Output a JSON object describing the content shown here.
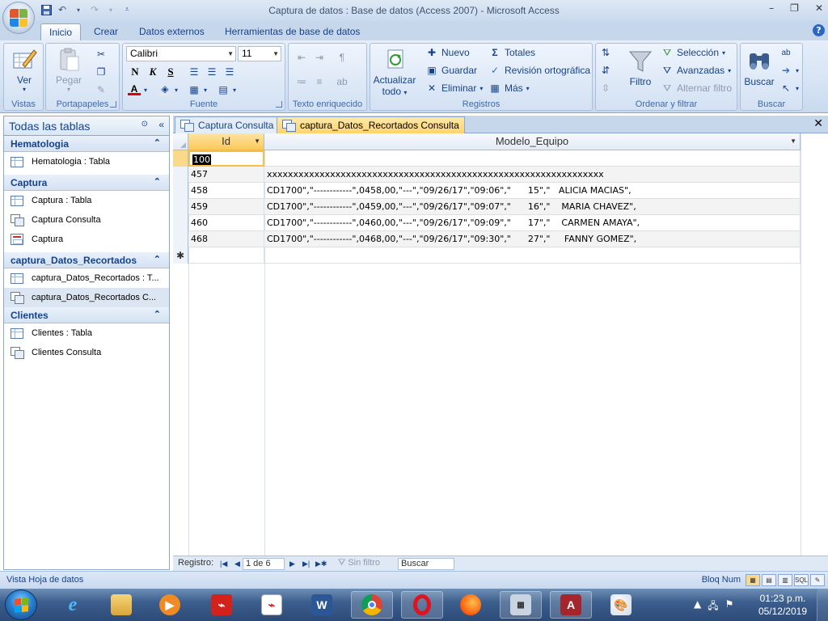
{
  "window": {
    "title": "Captura de datos : Base de datos (Access 2007) - Microsoft Access",
    "controls": [
      "–",
      "❐",
      "✕"
    ]
  },
  "ribbon": {
    "tabs": [
      "Inicio",
      "Crear",
      "Datos externos",
      "Herramientas de base de datos"
    ],
    "active_tab": "Inicio",
    "groups": {
      "vistas": {
        "label": "Vistas",
        "ver": "Ver"
      },
      "portapapeles": {
        "label": "Portapapeles",
        "pegar": "Pegar"
      },
      "fuente": {
        "label": "Fuente",
        "font": "Calibri",
        "size": "11",
        "bold": "N",
        "italic": "K",
        "underline": "S"
      },
      "texto": {
        "label": "Texto enriquecido"
      },
      "registros": {
        "label": "Registros",
        "actualizar": "Actualizar",
        "todo": "todo",
        "nuevo": "Nuevo",
        "guardar": "Guardar",
        "eliminar": "Eliminar",
        "totales": "Totales",
        "revision": "Revisión ortográfica",
        "mas": "Más"
      },
      "ordenar": {
        "label": "Ordenar y filtrar",
        "filtro": "Filtro",
        "seleccion": "Selección",
        "avanzadas": "Avanzadas",
        "alternar": "Alternar filtro"
      },
      "buscar": {
        "label": "Buscar",
        "buscar": "Buscar"
      }
    }
  },
  "navpane": {
    "title": "Todas las tablas",
    "groups": [
      {
        "name": "Hematologia",
        "items": [
          {
            "type": "table",
            "label": "Hematologia : Tabla"
          }
        ]
      },
      {
        "name": "Captura",
        "items": [
          {
            "type": "table",
            "label": "Captura : Tabla"
          },
          {
            "type": "query",
            "label": "Captura Consulta"
          },
          {
            "type": "form",
            "label": "Captura"
          }
        ]
      },
      {
        "name": "captura_Datos_Recortados",
        "items": [
          {
            "type": "table",
            "label": "captura_Datos_Recortados : T..."
          },
          {
            "type": "query",
            "label": "captura_Datos_Recortados C...",
            "selected": true
          }
        ]
      },
      {
        "name": "Clientes",
        "items": [
          {
            "type": "table",
            "label": "Clientes : Tabla"
          },
          {
            "type": "query",
            "label": "Clientes Consulta"
          }
        ]
      }
    ]
  },
  "doc_tabs": [
    {
      "label": "Captura Consulta",
      "active": false
    },
    {
      "label": "captura_Datos_Recortados Consulta",
      "active": true
    }
  ],
  "datasheet": {
    "columns": [
      "Id",
      "Modelo_Equipo"
    ],
    "rows": [
      {
        "id": "100",
        "modelo": ""
      },
      {
        "id": "457",
        "modelo": "xxxxxxxxxxxxxxxxxxxxxxxxxxxxxxxxxxxxxxxxxxxxxxxxxxxxxxxxxxxxxxxx"
      },
      {
        "id": "458",
        "modelo": "CD1700\",\"------------\",0458,00,\"---\",\"09/26/17\",\"09:06\",\"      15\",\"   ALICIA MACIAS\","
      },
      {
        "id": "459",
        "modelo": "CD1700\",\"------------\",0459,00,\"---\",\"09/26/17\",\"09:07\",\"      16\",\"    MARIA CHAVEZ\","
      },
      {
        "id": "460",
        "modelo": "CD1700\",\"------------\",0460,00,\"---\",\"09/26/17\",\"09:09\",\"      17\",\"    CARMEN AMAYA\","
      },
      {
        "id": "468",
        "modelo": "CD1700\",\"------------\",0468,00,\"---\",\"09/26/17\",\"09:30\",\"      27\",\"     FANNY GOMEZ\","
      }
    ],
    "new_row_marker": "✱"
  },
  "record_nav": {
    "label": "Registro:",
    "position": "1 de 6",
    "filter": "Sin filtro",
    "search": "Buscar"
  },
  "status": {
    "left": "Vista Hoja de datos",
    "right": "Bloq Num"
  },
  "taskbar": {
    "time": "01:23 p.m.",
    "date": "05/12/2019"
  }
}
